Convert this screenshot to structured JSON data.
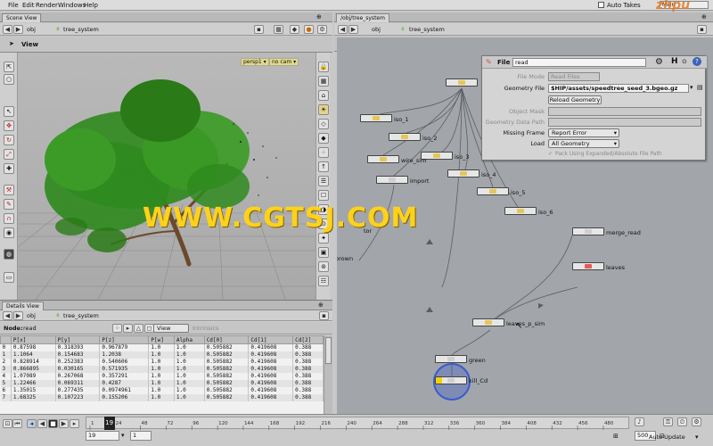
{
  "menu": [
    "File",
    "Edit",
    "Render",
    "Windows",
    "Help"
  ],
  "topbar": {
    "autotakes": "Auto Takes",
    "main": "Main"
  },
  "scene": {
    "tab": "Scene View",
    "path": "obj",
    "crumb": "tree_system",
    "view_label": "View",
    "persp": "persp1 ▾",
    "cam": "no cam ▾"
  },
  "network": {
    "tab": "/obj/tree_system",
    "path": "obj",
    "crumb": "tree_system",
    "nodes": [
      {
        "label": "iso_1"
      },
      {
        "label": "iso_2"
      },
      {
        "label": "iso_3"
      },
      {
        "label": "iso_4"
      },
      {
        "label": "iso_5"
      },
      {
        "label": "iso_6"
      },
      {
        "label": "wire_sim"
      },
      {
        "label": "import"
      },
      {
        "label": "merge_read"
      },
      {
        "label": "leaves"
      },
      {
        "label": "leaves_p_sim"
      },
      {
        "label": "green"
      },
      {
        "label": "kill_Cd"
      },
      {
        "label": "tor"
      },
      {
        "label": "brown"
      }
    ]
  },
  "params": {
    "type": "File",
    "name": "read",
    "rows": [
      {
        "label": "File Mode",
        "value": "Read Files",
        "disabled": true
      },
      {
        "label": "Geometry File",
        "value": "$HIP/assets/speedtree_seed_3.bgeo.gz",
        "disabled": false
      },
      {
        "label": "",
        "button": "Reload Geometry"
      },
      {
        "label": "Object Mask",
        "value": "",
        "disabled": true
      },
      {
        "label": "Geometry Data Path",
        "value": "",
        "disabled": true
      },
      {
        "label": "Missing Frame",
        "drop": "Report Error"
      },
      {
        "label": "Load",
        "drop": "All Geometry"
      }
    ],
    "pack": "Pack Using Expanded/Absolute File Path"
  },
  "details": {
    "tab": "Details View",
    "path": "obj",
    "crumb": "tree_system",
    "node_label": "Node:",
    "node_value": "read",
    "view": "View",
    "intrinsics": "Intrinsics",
    "columns": [
      "",
      "P[x]",
      "P[y]",
      "P[z]",
      "P[w]",
      "Alpha",
      "Cd[0]",
      "Cd[1]",
      "Cd[2]"
    ],
    "rows": [
      [
        "0",
        "0.87598",
        "0.318393",
        "0.967879",
        "1.0",
        "1.0",
        "0.505882",
        "0.419608",
        "0.388"
      ],
      [
        "1",
        "1.1064",
        "0.154683",
        "1.2038",
        "1.0",
        "1.0",
        "0.505882",
        "0.419608",
        "0.388"
      ],
      [
        "2",
        "0.828914",
        "0.252383",
        "0.540606",
        "1.0",
        "1.0",
        "0.505882",
        "0.419608",
        "0.388"
      ],
      [
        "3",
        "0.866895",
        "0.030165",
        "0.571935",
        "1.0",
        "1.0",
        "0.505882",
        "0.419608",
        "0.388"
      ],
      [
        "4",
        "1.07089",
        "0.267068",
        "0.357291",
        "1.0",
        "1.0",
        "0.505882",
        "0.419608",
        "0.388"
      ],
      [
        "5",
        "1.22466",
        "0.069311",
        "0.4287",
        "1.0",
        "1.0",
        "0.505882",
        "0.419608",
        "0.388"
      ],
      [
        "6",
        "1.35015",
        "0.277435",
        "0.0974961",
        "1.0",
        "1.0",
        "0.505882",
        "0.419608",
        "0.388"
      ],
      [
        "7",
        "1.68325",
        "0.107223",
        "0.155206",
        "1.0",
        "1.0",
        "0.505882",
        "0.419608",
        "0.388"
      ]
    ]
  },
  "timeline": {
    "frame": "19",
    "start": "1",
    "end": "500",
    "ticks": [
      "1",
      "24",
      "48",
      "72",
      "96",
      "120",
      "144",
      "168",
      "192",
      "216",
      "240",
      "264",
      "288",
      "312",
      "336",
      "360",
      "384",
      "408",
      "432",
      "456",
      "480"
    ],
    "autoupdate": "Auto Update"
  },
  "watermark": "WWW.CGTSJ.COM",
  "logo": "zhpu",
  "colors": {
    "leaf": "#2f8a1e",
    "trunk": "#6a4a2a",
    "watermark": "#ffd21a",
    "node_flag": "#e6c65a"
  }
}
